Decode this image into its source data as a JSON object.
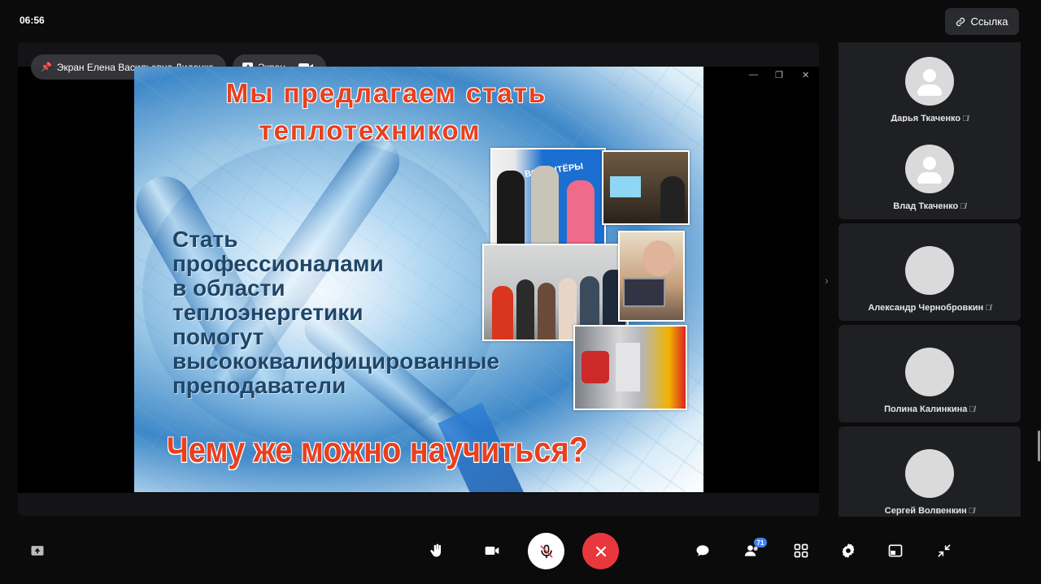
{
  "status": {
    "time": "06:56"
  },
  "header": {
    "link_label": "Ссылка"
  },
  "stage": {
    "presenter_label": "Экран Елена Васильевна Диденко",
    "screen_label": "Экран"
  },
  "slide": {
    "title_line1": "Мы предлагаем стать",
    "title_line2": "теплотехником",
    "body_lines": [
      "Стать",
      "профессионалами",
      "в  области",
      "теплоэнергетики",
      "помогут",
      "высококвалифицированные",
      "преподаватели"
    ],
    "bottom_question": "Чему же можно научиться?",
    "photo_banner_text": "ВОЛОНТЁРЫ"
  },
  "participants": [
    {
      "name": "Дарья Ткаченко",
      "avatar": "default-avatar"
    },
    {
      "name": "Влад Ткаченко",
      "avatar": "default-avatar"
    },
    {
      "name": "Александр Чернобровкин",
      "avatar": "anime-avatar"
    },
    {
      "name": "Полина Калинкина",
      "avatar": "photo-avatar"
    },
    {
      "name": "Сергей Волвенкин",
      "avatar": "anime-avatar"
    }
  ],
  "toolbar": {
    "participants_count": "71"
  },
  "colors": {
    "accent_red": "#e8383d",
    "badge_blue": "#3b82f6",
    "slide_title": "#e8401f",
    "slide_body": "#1f4668"
  }
}
